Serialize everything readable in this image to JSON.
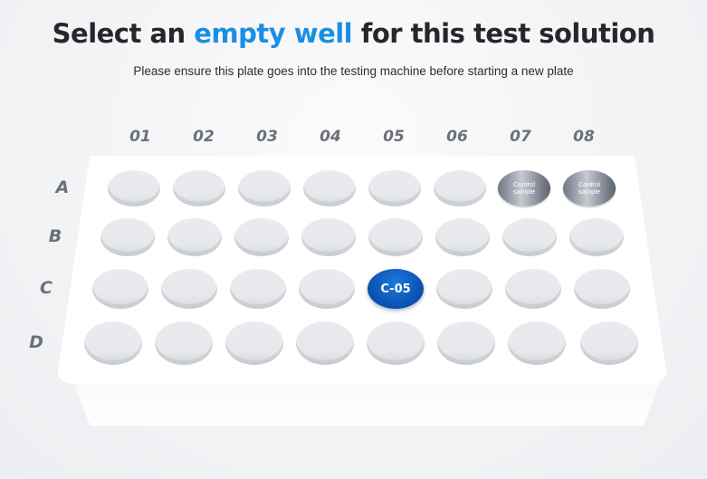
{
  "header": {
    "title_prefix": "Select an ",
    "title_accent": "empty well",
    "title_suffix": " for this test solution",
    "subtitle": "Please ensure this plate goes into the testing machine before starting a new plate",
    "accent_color": "#1a8fe3"
  },
  "plate": {
    "columns": [
      "01",
      "02",
      "03",
      "04",
      "05",
      "06",
      "07",
      "08"
    ],
    "rows": [
      "A",
      "B",
      "C",
      "D"
    ],
    "control_label": "Control\nsample",
    "selected_well": "C-05",
    "wells": [
      {
        "id": "A-01",
        "state": "empty"
      },
      {
        "id": "A-02",
        "state": "empty"
      },
      {
        "id": "A-03",
        "state": "empty"
      },
      {
        "id": "A-04",
        "state": "empty"
      },
      {
        "id": "A-05",
        "state": "empty"
      },
      {
        "id": "A-06",
        "state": "empty"
      },
      {
        "id": "A-07",
        "state": "control"
      },
      {
        "id": "A-08",
        "state": "control"
      },
      {
        "id": "B-01",
        "state": "empty"
      },
      {
        "id": "B-02",
        "state": "empty"
      },
      {
        "id": "B-03",
        "state": "empty"
      },
      {
        "id": "B-04",
        "state": "empty"
      },
      {
        "id": "B-05",
        "state": "empty"
      },
      {
        "id": "B-06",
        "state": "empty"
      },
      {
        "id": "B-07",
        "state": "empty"
      },
      {
        "id": "B-08",
        "state": "empty"
      },
      {
        "id": "C-01",
        "state": "empty"
      },
      {
        "id": "C-02",
        "state": "empty"
      },
      {
        "id": "C-03",
        "state": "empty"
      },
      {
        "id": "C-04",
        "state": "empty"
      },
      {
        "id": "C-05",
        "state": "selected"
      },
      {
        "id": "C-06",
        "state": "empty"
      },
      {
        "id": "C-07",
        "state": "empty"
      },
      {
        "id": "C-08",
        "state": "empty"
      },
      {
        "id": "D-01",
        "state": "empty"
      },
      {
        "id": "D-02",
        "state": "empty"
      },
      {
        "id": "D-03",
        "state": "empty"
      },
      {
        "id": "D-04",
        "state": "empty"
      },
      {
        "id": "D-05",
        "state": "empty"
      },
      {
        "id": "D-06",
        "state": "empty"
      },
      {
        "id": "D-07",
        "state": "empty"
      },
      {
        "id": "D-08",
        "state": "empty"
      }
    ],
    "colors": {
      "selected": "#0a56b5",
      "empty": "#e7e9ec",
      "control": "#8a909b"
    }
  }
}
